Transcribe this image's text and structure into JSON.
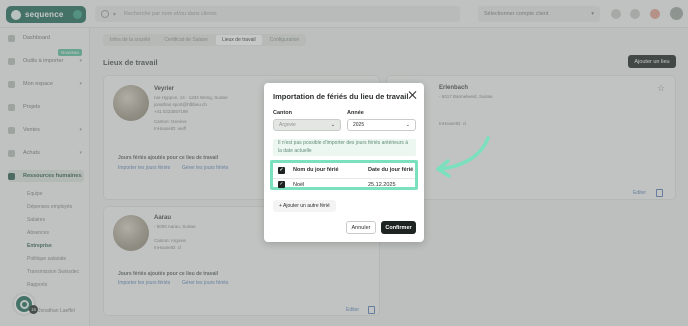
{
  "topbar": {
    "logo": "sequence",
    "search_placeholder": "Recherche par nom et/ou dans clients",
    "account_placeholder": "Sélectionner compte client"
  },
  "sidebar": {
    "items": [
      {
        "label": "Dashboard"
      },
      {
        "label": "Outils à importer"
      },
      {
        "label": "Mon espace"
      },
      {
        "label": "Projets"
      },
      {
        "label": "Ventes"
      },
      {
        "label": "Achats"
      },
      {
        "label": "Ressources humaines"
      }
    ],
    "badge_new": "Nouveau",
    "subitems": [
      "Equipe",
      "Dépenses employés",
      "Salaires",
      "Absences",
      "Entreprise",
      "Politique salariale",
      "Transmission Swissdec",
      "Rapports"
    ],
    "support_count": "15",
    "user_label": "Jonathan Laeffel"
  },
  "main": {
    "tabs": [
      "Infos de la société",
      "Certificat de Salaire",
      "Lieux de travail",
      "Configuration"
    ],
    "title": "Lieux de travail",
    "add_button": "Ajouter un lieu",
    "cards": [
      {
        "name": "Veyrier",
        "lines": [
          "rue Hyppon, 14 - 1234 Weng, Suisse",
          "jonathan.sport@hfbbeu.ch",
          "+41 0223557198",
          "Canton: Genève",
          "InHouseID: wuff"
        ],
        "section_title": "Jours fériés ajoutés pour ce lieu de travail",
        "link1": "Importer les jours fériés",
        "link2": "Gérer les jours fériés",
        "edit": "Editer"
      },
      {
        "name": "Erlenbach",
        "lines": [
          "- 5017 Barmelweid, Suisse",
          "",
          "",
          "",
          "InHouseID: cl"
        ],
        "section_title": "Jours fériés ajoutés pour ce lieu de travail",
        "link1": "Importer les jours fériés",
        "link2": "Gérer les jours fériés",
        "edit": "Editer"
      },
      {
        "name": "Aarau",
        "lines": [
          "- 5000 Aarau, Suisse",
          "",
          "Canton: Argovie",
          "InHouseID: cl"
        ],
        "section_title": "Jours fériés ajoutés pour ce lieu de travail",
        "link1": "Importer les jours fériés",
        "link2": "Gérer les jours fériés",
        "edit": "Editer"
      }
    ]
  },
  "modal": {
    "title": "Importation de fériés du lieu de travail",
    "canton_label": "Canton",
    "canton_value": "Argovie",
    "year_label": "Année",
    "year_value": "2025",
    "info_text": "Il n'est pas possible d'importer des jours fériés antérieurs à la date actuelle",
    "table": {
      "headers": [
        "Nom du jour férié",
        "Date du jour férié"
      ],
      "rows": [
        {
          "name": "Noël",
          "date": "25.12.2025",
          "checked": true
        }
      ]
    },
    "add_holiday": "+ Ajouter un autre férié",
    "cancel": "Annuler",
    "confirm": "Confirmer"
  },
  "colors": {
    "brand": "#1f6b5a",
    "highlight": "#7be0bd",
    "dark_button": "#1d2421"
  }
}
